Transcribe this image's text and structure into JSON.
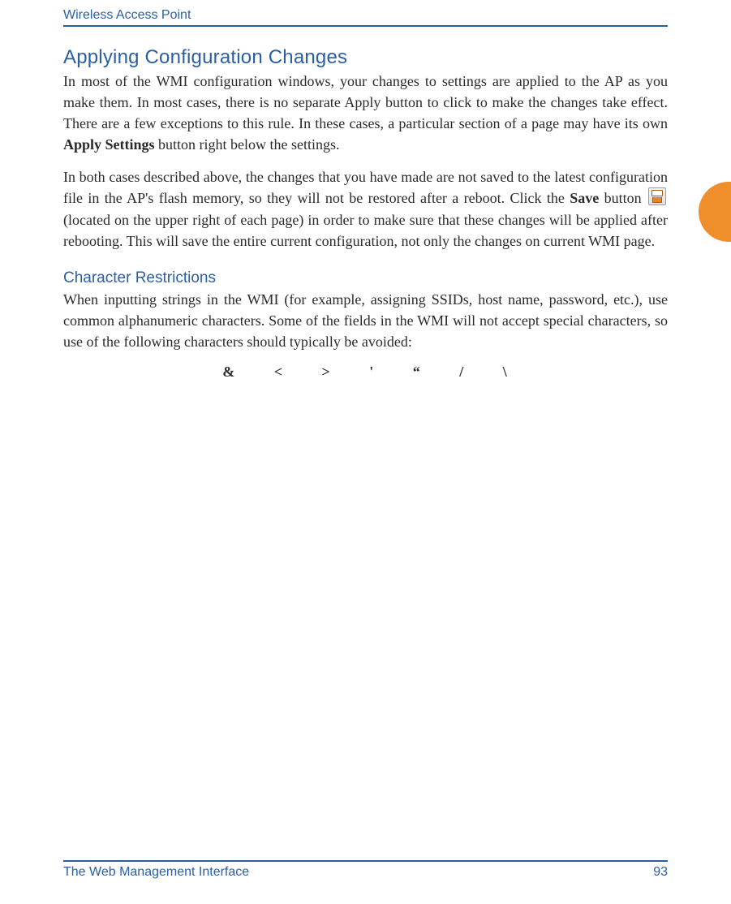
{
  "header": {
    "running_title": "Wireless Access Point"
  },
  "section1": {
    "title": "Applying Configuration Changes",
    "para1_pre": "In most of the WMI configuration windows, your changes to settings are applied to the AP as you make them. In most cases, there is no separate Apply button to click to make the changes take effect. There are a few exceptions to this rule. In these cases, a particular section of a page may have its own ",
    "para1_bold": "Apply Settings",
    "para1_post": " button right below the settings.",
    "para2_pre": "In both cases described above, the changes that you have made are not saved to the latest configuration file in the AP's flash memory, so they will not be restored after a reboot. Click the ",
    "para2_savebold": "Save",
    "para2_mid": " button ",
    "para2_post": " (located on the upper right of each page) in order to make sure that these changes will be applied after rebooting. This will save the entire current configuration, not only the changes on current WMI page."
  },
  "section2": {
    "title": "Character Restrictions",
    "para": "When inputting strings in the WMI (for example, assigning SSIDs, host name, password, etc.), use common alphanumeric characters. Some of the fields in the WMI will not accept special characters, so use of the following characters should typically be avoided:",
    "chars": "& < > ' “ / \\"
  },
  "footer": {
    "section_name": "The Web Management Interface",
    "page_number": "93"
  }
}
